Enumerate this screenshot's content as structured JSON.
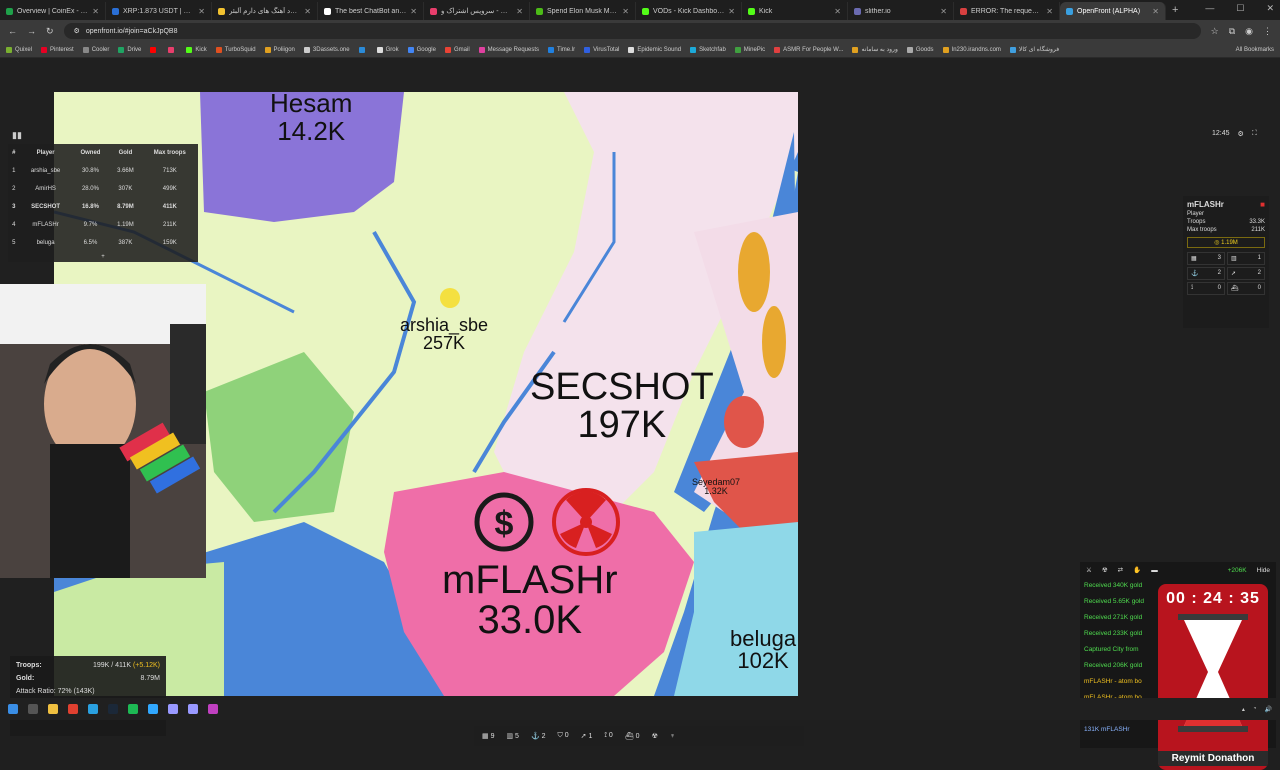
{
  "browser": {
    "tabs": [
      {
        "title": "Overview | CoinEx - The G",
        "color": "#1fa14a"
      },
      {
        "title": "XRP:1.873 USDT | Futures",
        "color": "#2a6fd6"
      },
      {
        "title": "دانلود آهنگ های دارم آلبئر",
        "color": "#f2c230"
      },
      {
        "title": "The best ChatBot and Wri",
        "color": "#ffffff"
      },
      {
        "title": "آپارات - سرویس اشتراک و",
        "color": "#e83e6c"
      },
      {
        "title": "Spend Elon Musk Money",
        "color": "#4cbb17"
      },
      {
        "title": "VODs - Kick Dashboard",
        "color": "#53fc18"
      },
      {
        "title": "Kick",
        "color": "#53fc18"
      },
      {
        "title": "slither.io",
        "color": "#6a6ab0"
      },
      {
        "title": "ERROR: The request could",
        "color": "#d84040"
      },
      {
        "title": "OpenFront (ALPHA)",
        "color": "#3aa0e0",
        "active": true
      }
    ],
    "url": "openfront.io/#join=aCkJpQB8",
    "bookmarks": [
      {
        "label": "Quixel",
        "color": "#7ab030"
      },
      {
        "label": "Pinterest",
        "color": "#e60023"
      },
      {
        "label": "Cooler",
        "color": "#888888"
      },
      {
        "label": "Drive",
        "color": "#1fa463"
      },
      {
        "label": "",
        "color": "#ff0000"
      },
      {
        "label": "",
        "color": "#e83e6c"
      },
      {
        "label": "Kick",
        "color": "#53fc18"
      },
      {
        "label": "TurboSquid",
        "color": "#e05020"
      },
      {
        "label": "Poliigon",
        "color": "#e0a020"
      },
      {
        "label": "3Dassets.one",
        "color": "#cccccc"
      },
      {
        "label": "",
        "color": "#2b8bd8"
      },
      {
        "label": "Grok",
        "color": "#dddddd"
      },
      {
        "label": "Google",
        "color": "#4285f4"
      },
      {
        "label": "Gmail",
        "color": "#ea4335"
      },
      {
        "label": "Message Requests",
        "color": "#e040a0"
      },
      {
        "label": "Time.lr",
        "color": "#2080e0"
      },
      {
        "label": "VirusTotal",
        "color": "#3060e0"
      },
      {
        "label": "Epidemic Sound",
        "color": "#dddddd"
      },
      {
        "label": "Sketchfab",
        "color": "#1caad9"
      },
      {
        "label": "MinePic",
        "color": "#40a040"
      },
      {
        "label": "ASMR For People W...",
        "color": "#e04040"
      },
      {
        "label": "ورود به سامانه",
        "color": "#e0a020"
      },
      {
        "label": "Goods",
        "color": "#aaaaaa"
      },
      {
        "label": "In230.irandns.com",
        "color": "#e0a020"
      },
      {
        "label": "فروشگاه ای کالا",
        "color": "#40a0e0"
      }
    ],
    "all_bookmarks": "All Bookmarks"
  },
  "leaderboard": {
    "headers": [
      "#",
      "Player",
      "Owned",
      "Gold",
      "Max troops"
    ],
    "rows": [
      {
        "rank": "1",
        "player": "arshia_sbe",
        "owned": "30.8%",
        "gold": "3.66M",
        "max": "713K"
      },
      {
        "rank": "2",
        "player": "AmirHS",
        "owned": "28.0%",
        "gold": "307K",
        "max": "499K"
      },
      {
        "rank": "3",
        "player": "SECSHOT",
        "owned": "16.8%",
        "gold": "8.79M",
        "max": "411K"
      },
      {
        "rank": "4",
        "player": "mFLASHr",
        "owned": "9.7%",
        "gold": "1.19M",
        "max": "211K"
      },
      {
        "rank": "5",
        "player": "beluga",
        "owned": "6.5%",
        "gold": "387K",
        "max": "159K"
      }
    ],
    "more": "+"
  },
  "map_labels": {
    "hesam_name": "Hesam",
    "hesam_troops": "14.2K",
    "arshia_name": "arshia_sbe",
    "arshia_troops": "257K",
    "secshot_name": "SECSHOT",
    "secshot_troops": "197K",
    "mflashr_name": "mFLASHr",
    "mflashr_troops": "33.0K",
    "beluga_name": "beluga",
    "beluga_troops": "102K",
    "seyedam_name": "Seyedam07",
    "seyedam_troops": "1.32K"
  },
  "control_panel": {
    "troops_label": "Troops:",
    "troops_value": "199K / 411K",
    "troops_delta": "(+5.12K)",
    "gold_label": "Gold:",
    "gold_value": "8.79M",
    "attack_ratio": "Attack Ratio: 72% (143K)",
    "attack_ratio_value": 0.72
  },
  "clock": "12:45",
  "player_info": {
    "name": "mFLASHr",
    "type": "Player",
    "troops_label": "Troops",
    "troops": "33.3K",
    "max_label": "Max troops",
    "max": "211K",
    "gold": "1.19M",
    "cities": "3",
    "factories": "1",
    "ports": "2",
    "missile": "2",
    "sam": "0",
    "warships": "0"
  },
  "events": {
    "increase": "+206K",
    "hide": "Hide",
    "items": [
      {
        "text": "Received 340K gold",
        "color": "#4fdc4f"
      },
      {
        "text": "Received 5.65K gold",
        "color": "#4fdc4f"
      },
      {
        "text": "Received 271K gold",
        "color": "#4fdc4f"
      },
      {
        "text": "Received 233K gold",
        "color": "#4fdc4f"
      },
      {
        "text": "Captured City from",
        "color": "#4fdc4f"
      },
      {
        "text": "Received 206K gold",
        "color": "#4fdc4f"
      },
      {
        "text": "mFLASHr - atom bo",
        "color": "#f0c020"
      },
      {
        "text": "mFLASHr - atom bo",
        "color": "#f0c020"
      },
      {
        "text": "26.8K arshiya1t",
        "color": "#ff5050"
      },
      {
        "text": "131K mFLASHr",
        "color": "#8ab4ff"
      }
    ]
  },
  "timer": {
    "time": "00 : 24 : 35",
    "label": "Reymit Donathon"
  },
  "bottom_bar": {
    "cities": "9",
    "factories": "5",
    "ports": "2",
    "defense": "0",
    "missile": "1",
    "sam": "0",
    "warships": "0"
  }
}
